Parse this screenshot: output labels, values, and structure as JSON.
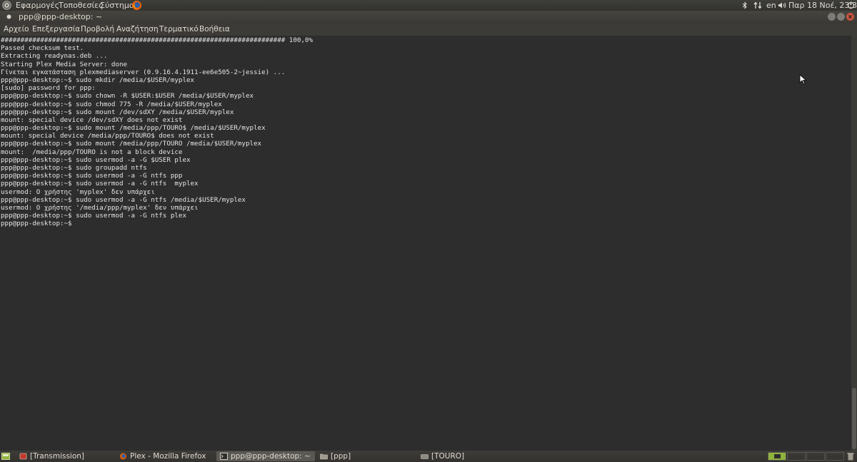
{
  "top_panel": {
    "menus": [
      "Εφαρμογές",
      "Τοποθεσίες",
      "Σύστημα"
    ],
    "tray": {
      "language": "en",
      "datetime": "Παρ 18 Νοέ, 23:36"
    },
    "icons": [
      "ubuntu-logo-icon",
      "firefox-icon",
      "bluetooth-icon",
      "network-icon",
      "volume-icon",
      "power-icon"
    ]
  },
  "window": {
    "title": "ppp@ppp-desktop: ~",
    "menu": [
      "Αρχείο",
      "Επεξεργασία",
      "Προβολή",
      "Αναζήτηση",
      "Τερματικό",
      "Βοήθεια"
    ]
  },
  "terminal": {
    "lines": [
      "######################################################################## 100,0%",
      "Passed checksum test.",
      "Extracting readynas.deb ...",
      "Starting Plex Media Server: done",
      "Γίνεται εγκατάσταση plexmediaserver (0.9.16.4.1911-ee6e505-2~jessie) ...",
      "ppp@ppp-desktop:~$ sudo mkdir /media/$USER/myplex",
      "[sudo] password for ppp:",
      "ppp@ppp-desktop:~$ sudo chown -R $USER:$USER /media/$USER/myplex",
      "ppp@ppp-desktop:~$ sudo chmod 775 -R /media/$USER/myplex",
      "ppp@ppp-desktop:~$ sudo mount /dev/sdXY /media/$USER/myplex",
      "mount: special device /dev/sdXY does not exist",
      "ppp@ppp-desktop:~$ sudo mount /media/ppp/TOURO$ /media/$USER/myplex",
      "mount: special device /media/ppp/TOURO$ does not exist",
      "ppp@ppp-desktop:~$ sudo mount /media/ppp/TOURO /media/$USER/myplex",
      "mount:  /media/ppp/TOURO is not a block device",
      "ppp@ppp-desktop:~$ sudo usermod -a -G $USER plex",
      "ppp@ppp-desktop:~$ sudo groupadd ntfs",
      "ppp@ppp-desktop:~$ sudo usermod -a -G ntfs ppp",
      "ppp@ppp-desktop:~$ sudo usermod -a -G ntfs  myplex",
      "usermod: Ο χρήστης 'myplex' δεν υπάρχει",
      "ppp@ppp-desktop:~$ sudo usermod -a -G ntfs /media/$USER/myplex",
      "usermod: Ο χρήστης '/media/ppp/myplex' δεν υπάρχει",
      "ppp@ppp-desktop:~$ sudo usermod -a -G ntfs plex",
      "ppp@ppp-desktop:~$"
    ]
  },
  "taskbar": {
    "tasks": [
      {
        "label": "[Transmission]",
        "icon": "transmission-icon",
        "active": false
      },
      {
        "label": "Plex - Mozilla Firefox",
        "icon": "firefox-icon",
        "active": false
      },
      {
        "label": "ppp@ppp-desktop: ~",
        "icon": "terminal-icon",
        "active": true
      },
      {
        "label": "[ppp]",
        "icon": "folder-icon",
        "active": false
      },
      {
        "label": "[TOURO]",
        "icon": "drive-icon",
        "active": false
      }
    ],
    "workspaces": 4,
    "active_workspace": 1
  },
  "colors": {
    "terminal_bg": "#2d2d2d",
    "terminal_fg": "#e4e4e4",
    "panel_bg": "#3c3b37",
    "close_button": "#c8533e",
    "workspace_active": "#8fb33c"
  }
}
